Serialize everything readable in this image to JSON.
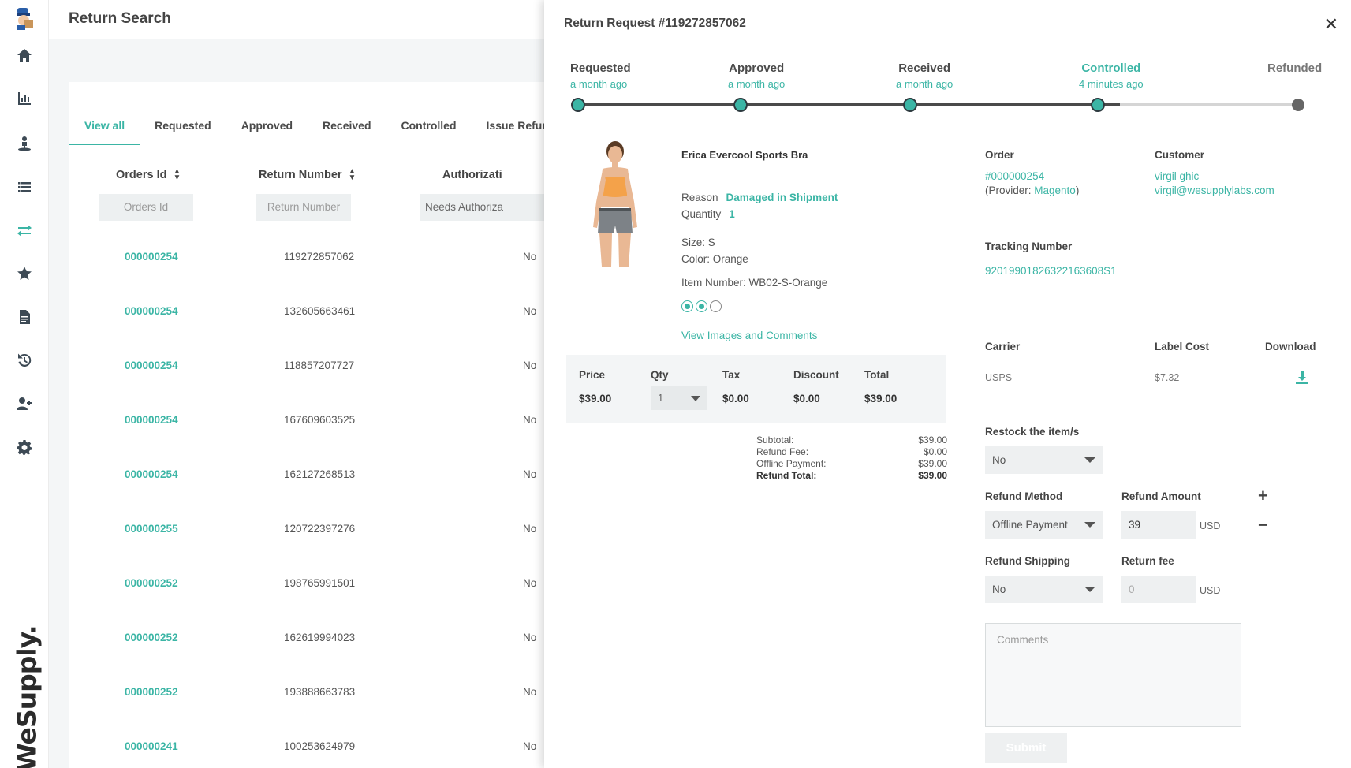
{
  "colors": {
    "accent": "#3bb5a5",
    "dark": "#3d4a55",
    "panel": "#f4f6f7"
  },
  "brand": {
    "name": "WeSupply."
  },
  "nav": {
    "icons": [
      "home-icon",
      "chart-icon",
      "user-pin-icon",
      "list-icon",
      "exchange-icon",
      "star-icon",
      "document-icon",
      "history-icon",
      "add-user-icon",
      "gear-icon"
    ],
    "active": "exchange-icon"
  },
  "list": {
    "title": "Return Search",
    "tabs": [
      "View all",
      "Requested",
      "Approved",
      "Received",
      "Controlled",
      "Issue Refund"
    ],
    "active_tab": "View all",
    "columns": {
      "orders_id": "Orders Id",
      "return_number": "Return Number",
      "authorization": "Authorizati"
    },
    "filters": {
      "orders_id": "Orders Id",
      "return_number": "Return Number",
      "authorization": "Needs Authoriza"
    },
    "rows": [
      {
        "order": "000000254",
        "return": "119272857062",
        "auth": "No"
      },
      {
        "order": "000000254",
        "return": "132605663461",
        "auth": "No"
      },
      {
        "order": "000000254",
        "return": "118857207727",
        "auth": "No"
      },
      {
        "order": "000000254",
        "return": "167609603525",
        "auth": "No"
      },
      {
        "order": "000000254",
        "return": "162127268513",
        "auth": "No"
      },
      {
        "order": "000000255",
        "return": "120722397276",
        "auth": "No"
      },
      {
        "order": "000000252",
        "return": "198765991501",
        "auth": "No"
      },
      {
        "order": "000000252",
        "return": "162619994023",
        "auth": "No"
      },
      {
        "order": "000000252",
        "return": "193888663783",
        "auth": "No"
      },
      {
        "order": "000000241",
        "return": "100253624979",
        "auth": "No"
      }
    ]
  },
  "drawer": {
    "title": "Return Request #119272857062",
    "close": "✕",
    "steps": [
      {
        "label": "Requested",
        "when": "a month ago",
        "state": "done"
      },
      {
        "label": "Approved",
        "when": "a month ago",
        "state": "done"
      },
      {
        "label": "Received",
        "when": "a month ago",
        "state": "done"
      },
      {
        "label": "Controlled",
        "when": "4 minutes ago",
        "state": "current"
      },
      {
        "label": "Refunded",
        "when": "",
        "state": "pending"
      }
    ],
    "product": {
      "name": "Erica Evercool Sports Bra",
      "reason_label": "Reason",
      "reason": "Damaged in Shipment",
      "quantity_label": "Quantity",
      "quantity": "1",
      "size": "Size: S",
      "color": "Color: Orange",
      "item_number": "Item Number: WB02-S-Orange",
      "view_link": "View Images and Comments"
    },
    "price": {
      "headers": {
        "price": "Price",
        "qty": "Qty",
        "tax": "Tax",
        "discount": "Discount",
        "total": "Total"
      },
      "price": "$39.00",
      "qty": "1",
      "tax": "$0.00",
      "discount": "$0.00",
      "total": "$39.00"
    },
    "summary": {
      "subtotal_label": "Subtotal:",
      "subtotal": "$39.00",
      "refund_fee_label": "Refund Fee:",
      "refund_fee": "$0.00",
      "offline_label": "Offline Payment:",
      "offline": "$39.00",
      "total_label": "Refund Total:",
      "total": "$39.00"
    },
    "order": {
      "label": "Order",
      "number": "#000000254",
      "provider_prefix": "(Provider: ",
      "provider": "Magento",
      "provider_suffix": ")",
      "customer_label": "Customer",
      "customer_name": "virgil ghic",
      "customer_email": "virgil@wesupplylabs.com",
      "tracking_label": "Tracking Number",
      "tracking": "92019901826322163608S1"
    },
    "shipping": {
      "carrier_label": "Carrier",
      "carrier": "USPS",
      "cost_label": "Label Cost",
      "cost": "$7.32",
      "download_label": "Download"
    },
    "form": {
      "restock_label": "Restock the item/s",
      "restock_value": "No",
      "method_label": "Refund Method",
      "method_value": "Offline Payment",
      "amount_label": "Refund Amount",
      "amount_value": "39",
      "amount_unit": "USD",
      "plus": "+",
      "minus": "−",
      "shipping_label": "Refund Shipping",
      "shipping_value": "No",
      "fee_label": "Return fee",
      "fee_placeholder": "0",
      "fee_unit": "USD",
      "comments_placeholder": "Comments",
      "submit": "Submit"
    }
  }
}
